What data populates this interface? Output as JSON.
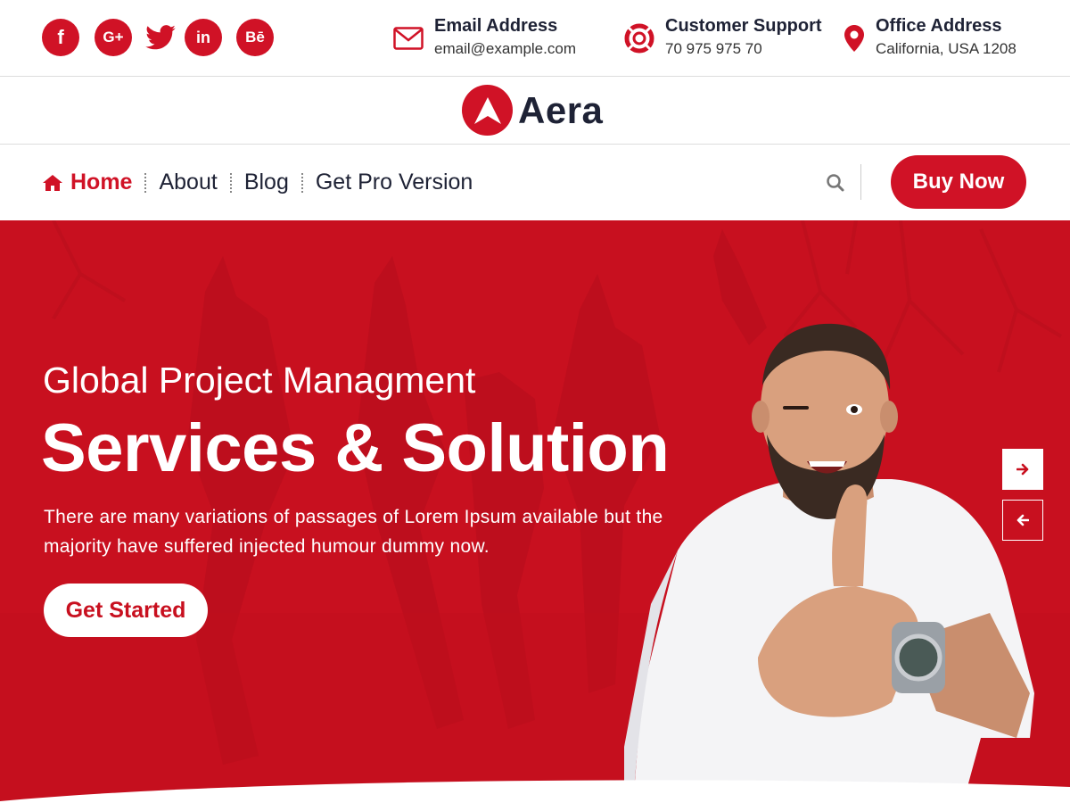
{
  "colors": {
    "accent": "#d01226",
    "dark": "#1e2235",
    "hero_bg": "#c8101f"
  },
  "social": [
    {
      "name": "facebook",
      "glyph": "f"
    },
    {
      "name": "google-plus",
      "glyph": "G+"
    },
    {
      "name": "twitter",
      "glyph": "twitter-bird"
    },
    {
      "name": "linkedin",
      "glyph": "in"
    },
    {
      "name": "behance",
      "glyph": "Bē"
    }
  ],
  "contacts": {
    "email": {
      "icon": "envelope-icon",
      "title": "Email Address",
      "value": "email@example.com"
    },
    "support": {
      "icon": "lifebuoy-icon",
      "title": "Customer Support",
      "value": "70 975 975 70"
    },
    "office": {
      "icon": "map-pin-icon",
      "title": "Office Address",
      "value": "California, USA 1208"
    }
  },
  "logo": {
    "text": "Aera"
  },
  "nav": {
    "items": [
      {
        "label": "Home",
        "icon": "home-icon",
        "active": true
      },
      {
        "label": "About"
      },
      {
        "label": "Blog"
      },
      {
        "label": "Get Pro Version"
      }
    ],
    "search_icon": "search-icon",
    "buy_label": "Buy Now"
  },
  "hero": {
    "subtitle": "Global Project Managment",
    "title": "Services & Solution",
    "text": "There are many variations of passages of Lorem Ipsum available but the majority have suffered injected humour dummy now.",
    "cta_label": "Get Started",
    "next_icon": "arrow-right-icon",
    "prev_icon": "arrow-left-icon"
  }
}
